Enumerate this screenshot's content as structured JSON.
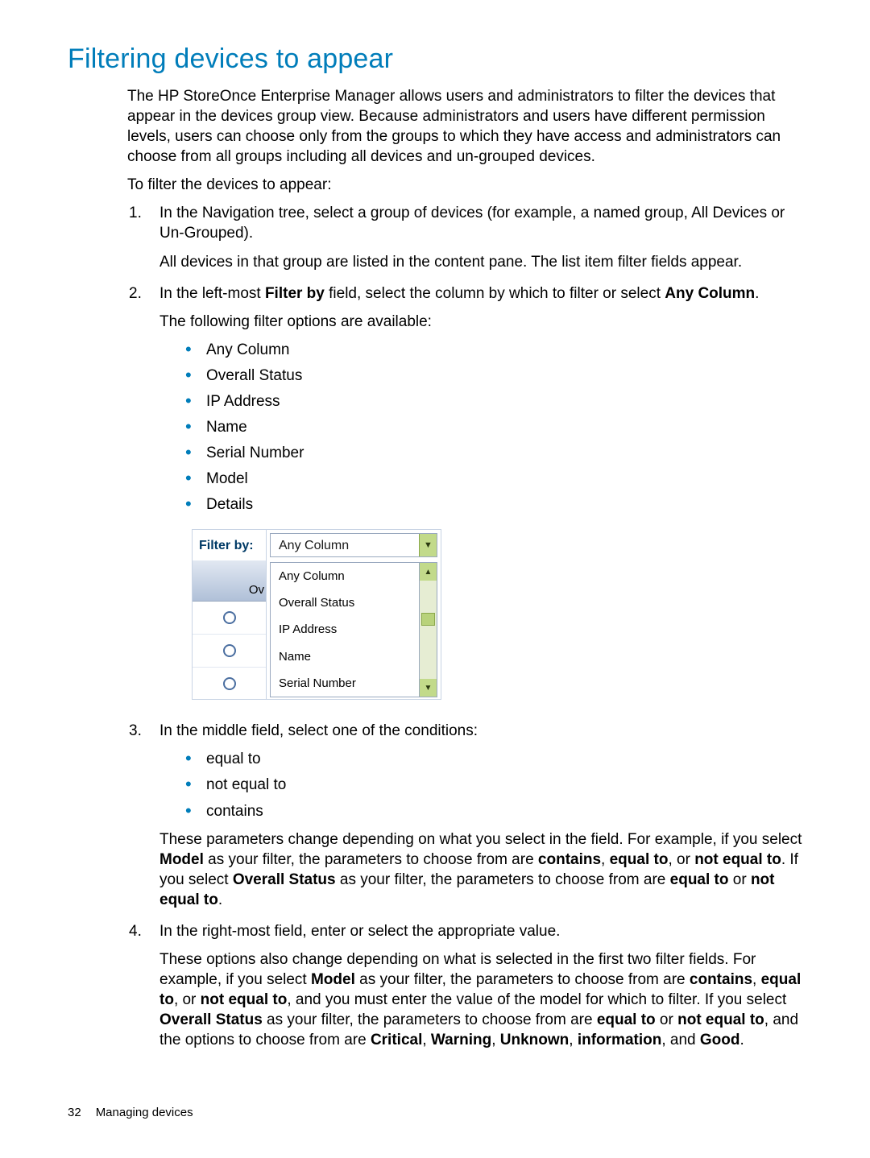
{
  "heading": "Filtering devices to appear",
  "intro": "The HP StoreOnce Enterprise Manager allows users and administrators to filter the devices that appear in the devices group view. Because administrators and users have different permission levels, users can choose only from the groups to which they have access and administrators can choose from all groups including all devices and un-grouped devices.",
  "lead": "To filter the devices to appear:",
  "step1_a": "In the Navigation tree, select a group of devices (for example, a named group, All Devices or Un-Grouped).",
  "step1_b": "All devices in that group are listed in the content pane. The list item filter fields appear.",
  "step2_prefix": "In the left-most ",
  "step2_bold1": "Filter by",
  "step2_mid": " field, select the column by which to filter or select ",
  "step2_bold2": "Any Column",
  "step2_suffix": ".",
  "step2_follow": "The following filter options are available:",
  "filter_opts": [
    "Any Column",
    "Overall Status",
    "IP Address",
    "Name",
    "Serial Number",
    "Model",
    "Details"
  ],
  "figure": {
    "label": "Filter by:",
    "selected": "Any Column",
    "ov": "Ov",
    "list": [
      "Any Column",
      "Overall Status",
      "IP Address",
      "Name",
      "Serial Number"
    ]
  },
  "step3_a": "In the middle field, select one of the conditions:",
  "conditions": [
    "equal to",
    "not equal to",
    "contains"
  ],
  "step3_b_pre": "These parameters change depending on what you select in the field. For example, if you select ",
  "step3_b_b1": "Model",
  "step3_b_m1": " as your filter, the parameters to choose from are ",
  "step3_b_b2": "contains",
  "step3_b_m2": ", ",
  "step3_b_b3": "equal to",
  "step3_b_m3": ", or ",
  "step3_b_b4": "not equal to",
  "step3_b_m4": ". If you select ",
  "step3_b_b5": "Overall Status",
  "step3_b_m5": " as your filter, the parameters to choose from are ",
  "step3_b_b6": "equal to",
  "step3_b_m6": " or ",
  "step3_b_b7": "not equal to",
  "step3_b_end": ".",
  "step4_a": "In the right-most field, enter or select the appropriate value.",
  "step4_b_pre": "These options also change depending on what is selected in the first two filter fields. For example, if you select ",
  "step4_b_b1": "Model",
  "step4_b_m1": " as your filter, the parameters to choose from are ",
  "step4_b_b2": "contains",
  "step4_b_m2": ", ",
  "step4_b_b3": "equal to",
  "step4_b_m3": ", or ",
  "step4_b_b4": "not equal to",
  "step4_b_m4": ", and you must enter the value of the model for which to filter. If you select ",
  "step4_b_b5": "Overall Status",
  "step4_b_m5": " as your filter, the parameters to choose from are ",
  "step4_b_b6": "equal to",
  "step4_b_m6": " or ",
  "step4_b_b7": "not equal to",
  "step4_b_m7": ", and the options to choose from are ",
  "step4_b_b8": "Critical",
  "step4_b_m8": ", ",
  "step4_b_b9": "Warning",
  "step4_b_m9": ", ",
  "step4_b_b10": "Unknown",
  "step4_b_m10": ", ",
  "step4_b_b11": "information",
  "step4_b_m11": ", and ",
  "step4_b_b12": "Good",
  "step4_b_end": ".",
  "footer_page": "32",
  "footer_title": "Managing devices"
}
